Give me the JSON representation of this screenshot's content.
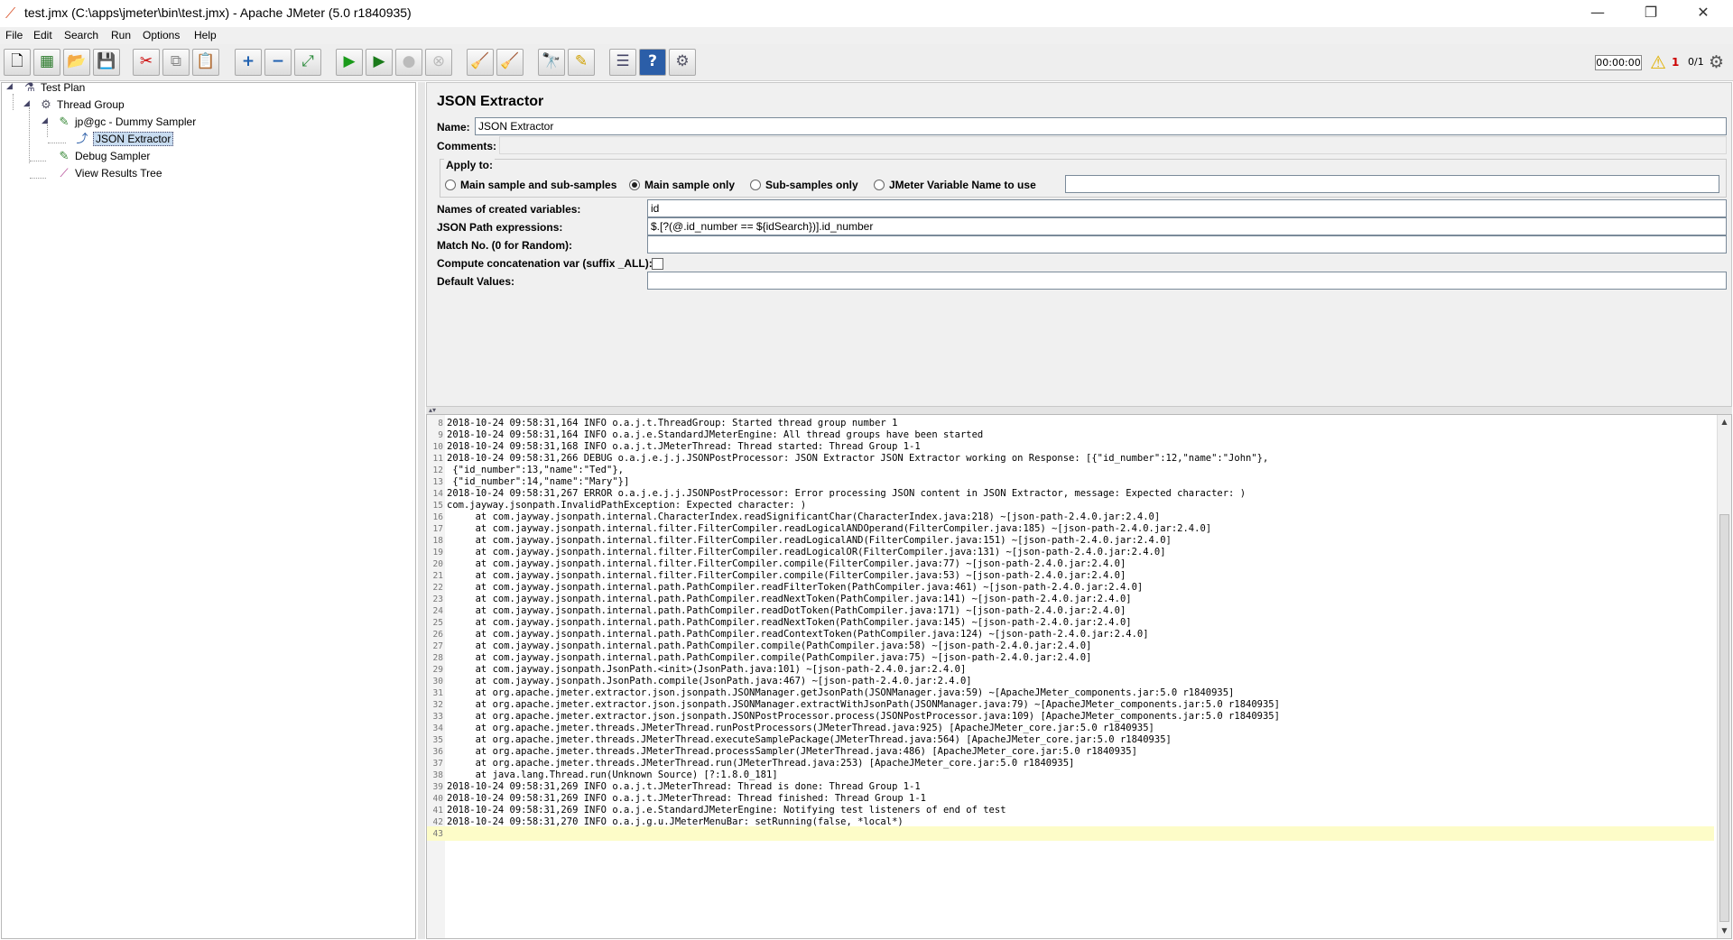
{
  "window": {
    "title": "test.jmx (C:\\apps\\jmeter\\bin\\test.jmx) - Apache JMeter (5.0 r1840935)",
    "minimize": "—",
    "maximize": "❐",
    "close": "✕"
  },
  "menu": [
    "File",
    "Edit",
    "Search",
    "Run",
    "Options",
    "Help"
  ],
  "toolbar": {
    "buttons": [
      {
        "name": "new-icon",
        "glyph": "🗋"
      },
      {
        "name": "templates-icon",
        "glyph": "▦"
      },
      {
        "name": "open-icon",
        "glyph": "📂"
      },
      {
        "name": "save-icon",
        "glyph": "💾"
      },
      {
        "name": "cut-icon",
        "glyph": "✂"
      },
      {
        "name": "copy-icon",
        "glyph": "⧉"
      },
      {
        "name": "paste-icon",
        "glyph": "📋"
      },
      {
        "name": "expand-icon",
        "glyph": "+"
      },
      {
        "name": "collapse-icon",
        "glyph": "−"
      },
      {
        "name": "toggle-icon",
        "glyph": "⤢"
      },
      {
        "name": "start-icon",
        "glyph": "▶"
      },
      {
        "name": "start-no-pauses-icon",
        "glyph": "▶"
      },
      {
        "name": "stop-icon",
        "glyph": "●"
      },
      {
        "name": "shutdown-icon",
        "glyph": "⊗"
      },
      {
        "name": "clear-icon",
        "glyph": "🧹"
      },
      {
        "name": "clear-all-icon",
        "glyph": "🧹"
      },
      {
        "name": "search-icon",
        "glyph": "🔭"
      },
      {
        "name": "reset-search-icon",
        "glyph": "✎"
      },
      {
        "name": "function-helper-icon",
        "glyph": "☰"
      },
      {
        "name": "help-icon",
        "glyph": "?"
      },
      {
        "name": "remote-icon",
        "glyph": "⚙"
      }
    ],
    "timer": "00:00:00",
    "warning_count": "1",
    "thread_count": "0/1"
  },
  "tree": {
    "nodes": [
      {
        "label": "Test Plan",
        "icon": "test-plan-icon"
      },
      {
        "label": "Thread Group",
        "icon": "gear-icon"
      },
      {
        "label": "jp@gc - Dummy Sampler",
        "icon": "sampler-icon"
      },
      {
        "label": "JSON Extractor",
        "icon": "extractor-icon"
      },
      {
        "label": "Debug Sampler",
        "icon": "sampler-icon"
      },
      {
        "label": "View Results Tree",
        "icon": "listener-icon"
      }
    ]
  },
  "editor": {
    "title": "JSON Extractor",
    "name_label": "Name:",
    "name_value": "JSON Extractor",
    "comments_label": "Comments:",
    "comments_value": "",
    "apply_to": {
      "legend": "Apply to:",
      "options": [
        {
          "label": "Main sample and sub-samples",
          "selected": false
        },
        {
          "label": "Main sample only",
          "selected": true
        },
        {
          "label": "Sub-samples only",
          "selected": false
        },
        {
          "label": "JMeter Variable Name to use",
          "selected": false
        }
      ],
      "variable_name": ""
    },
    "fields": [
      {
        "label": "Names of created variables:",
        "value": "id"
      },
      {
        "label": "JSON Path expressions:",
        "value": "$.[?(@.id_number == ${idSearch})].id_number"
      },
      {
        "label": "Match No. (0 for Random):",
        "value": ""
      },
      {
        "label": "Compute concatenation var (suffix _ALL):",
        "value": ""
      },
      {
        "label": "Default Values:",
        "value": ""
      }
    ],
    "compute_concat_checked": false
  },
  "log": {
    "lines": [
      {
        "n": "8",
        "text": "2018-10-24 09:58:31,164 INFO o.a.j.t.ThreadGroup: Started thread group number 1"
      },
      {
        "n": "9",
        "text": "2018-10-24 09:58:31,164 INFO o.a.j.e.StandardJMeterEngine: All thread groups have been started"
      },
      {
        "n": "10",
        "text": "2018-10-24 09:58:31,168 INFO o.a.j.t.JMeterThread: Thread started: Thread Group 1-1"
      },
      {
        "n": "11",
        "text": "2018-10-24 09:58:31,266 DEBUG o.a.j.e.j.j.JSONPostProcessor: JSON Extractor JSON Extractor working on Response: [{\"id_number\":12,\"name\":\"John\"},"
      },
      {
        "n": "12",
        "text": " {\"id_number\":13,\"name\":\"Ted\"},"
      },
      {
        "n": "13",
        "text": " {\"id_number\":14,\"name\":\"Mary\"}]"
      },
      {
        "n": "14",
        "text": "2018-10-24 09:58:31,267 ERROR o.a.j.e.j.j.JSONPostProcessor: Error processing JSON content in JSON Extractor, message: Expected character: )"
      },
      {
        "n": "15",
        "text": "com.jayway.jsonpath.InvalidPathException: Expected character: )"
      },
      {
        "n": "16",
        "text": "     at com.jayway.jsonpath.internal.CharacterIndex.readSignificantChar(CharacterIndex.java:218) ~[json-path-2.4.0.jar:2.4.0]"
      },
      {
        "n": "17",
        "text": "     at com.jayway.jsonpath.internal.filter.FilterCompiler.readLogicalANDOperand(FilterCompiler.java:185) ~[json-path-2.4.0.jar:2.4.0]"
      },
      {
        "n": "18",
        "text": "     at com.jayway.jsonpath.internal.filter.FilterCompiler.readLogicalAND(FilterCompiler.java:151) ~[json-path-2.4.0.jar:2.4.0]"
      },
      {
        "n": "19",
        "text": "     at com.jayway.jsonpath.internal.filter.FilterCompiler.readLogicalOR(FilterCompiler.java:131) ~[json-path-2.4.0.jar:2.4.0]"
      },
      {
        "n": "20",
        "text": "     at com.jayway.jsonpath.internal.filter.FilterCompiler.compile(FilterCompiler.java:77) ~[json-path-2.4.0.jar:2.4.0]"
      },
      {
        "n": "21",
        "text": "     at com.jayway.jsonpath.internal.filter.FilterCompiler.compile(FilterCompiler.java:53) ~[json-path-2.4.0.jar:2.4.0]"
      },
      {
        "n": "22",
        "text": "     at com.jayway.jsonpath.internal.path.PathCompiler.readFilterToken(PathCompiler.java:461) ~[json-path-2.4.0.jar:2.4.0]"
      },
      {
        "n": "23",
        "text": "     at com.jayway.jsonpath.internal.path.PathCompiler.readNextToken(PathCompiler.java:141) ~[json-path-2.4.0.jar:2.4.0]"
      },
      {
        "n": "24",
        "text": "     at com.jayway.jsonpath.internal.path.PathCompiler.readDotToken(PathCompiler.java:171) ~[json-path-2.4.0.jar:2.4.0]"
      },
      {
        "n": "25",
        "text": "     at com.jayway.jsonpath.internal.path.PathCompiler.readNextToken(PathCompiler.java:145) ~[json-path-2.4.0.jar:2.4.0]"
      },
      {
        "n": "26",
        "text": "     at com.jayway.jsonpath.internal.path.PathCompiler.readContextToken(PathCompiler.java:124) ~[json-path-2.4.0.jar:2.4.0]"
      },
      {
        "n": "27",
        "text": "     at com.jayway.jsonpath.internal.path.PathCompiler.compile(PathCompiler.java:58) ~[json-path-2.4.0.jar:2.4.0]"
      },
      {
        "n": "28",
        "text": "     at com.jayway.jsonpath.internal.path.PathCompiler.compile(PathCompiler.java:75) ~[json-path-2.4.0.jar:2.4.0]"
      },
      {
        "n": "29",
        "text": "     at com.jayway.jsonpath.JsonPath.<init>(JsonPath.java:101) ~[json-path-2.4.0.jar:2.4.0]"
      },
      {
        "n": "30",
        "text": "     at com.jayway.jsonpath.JsonPath.compile(JsonPath.java:467) ~[json-path-2.4.0.jar:2.4.0]"
      },
      {
        "n": "31",
        "text": "     at org.apache.jmeter.extractor.json.jsonpath.JSONManager.getJsonPath(JSONManager.java:59) ~[ApacheJMeter_components.jar:5.0 r1840935]"
      },
      {
        "n": "32",
        "text": "     at org.apache.jmeter.extractor.json.jsonpath.JSONManager.extractWithJsonPath(JSONManager.java:79) ~[ApacheJMeter_components.jar:5.0 r1840935]"
      },
      {
        "n": "33",
        "text": "     at org.apache.jmeter.extractor.json.jsonpath.JSONPostProcessor.process(JSONPostProcessor.java:109) [ApacheJMeter_components.jar:5.0 r1840935]"
      },
      {
        "n": "34",
        "text": "     at org.apache.jmeter.threads.JMeterThread.runPostProcessors(JMeterThread.java:925) [ApacheJMeter_core.jar:5.0 r1840935]"
      },
      {
        "n": "35",
        "text": "     at org.apache.jmeter.threads.JMeterThread.executeSamplePackage(JMeterThread.java:564) [ApacheJMeter_core.jar:5.0 r1840935]"
      },
      {
        "n": "36",
        "text": "     at org.apache.jmeter.threads.JMeterThread.processSampler(JMeterThread.java:486) [ApacheJMeter_core.jar:5.0 r1840935]"
      },
      {
        "n": "37",
        "text": "     at org.apache.jmeter.threads.JMeterThread.run(JMeterThread.java:253) [ApacheJMeter_core.jar:5.0 r1840935]"
      },
      {
        "n": "38",
        "text": "     at java.lang.Thread.run(Unknown Source) [?:1.8.0_181]"
      },
      {
        "n": "39",
        "text": "2018-10-24 09:58:31,269 INFO o.a.j.t.JMeterThread: Thread is done: Thread Group 1-1"
      },
      {
        "n": "40",
        "text": "2018-10-24 09:58:31,269 INFO o.a.j.t.JMeterThread: Thread finished: Thread Group 1-1"
      },
      {
        "n": "41",
        "text": "2018-10-24 09:58:31,269 INFO o.a.j.e.StandardJMeterEngine: Notifying test listeners of end of test"
      },
      {
        "n": "42",
        "text": "2018-10-24 09:58:31,270 INFO o.a.j.g.u.JMeterMenuBar: setRunning(false, *local*)"
      },
      {
        "n": "43",
        "text": ""
      }
    ]
  },
  "colors": {
    "current_line": "#fdfcc8",
    "panel_bg": "#f0f0f0",
    "selection": "#c8dcf0"
  }
}
